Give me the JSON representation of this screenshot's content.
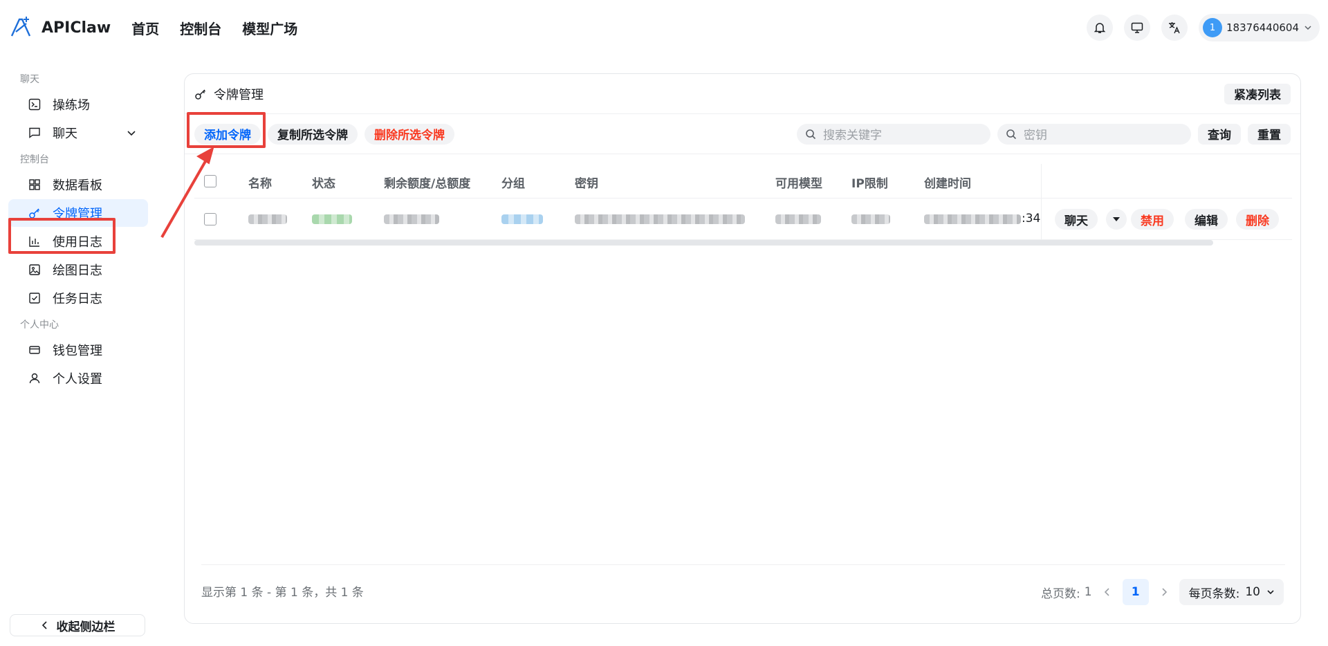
{
  "header": {
    "brand": "APIClaw",
    "nav": [
      "首页",
      "控制台",
      "模型广场"
    ],
    "user": {
      "avatar_letter": "1",
      "name": "18376440604"
    }
  },
  "sidebar": {
    "sections": [
      {
        "title": "聊天",
        "items": [
          "操练场",
          "聊天"
        ]
      },
      {
        "title": "控制台",
        "items": [
          "数据看板",
          "令牌管理",
          "使用日志",
          "绘图日志",
          "任务日志"
        ]
      },
      {
        "title": "个人中心",
        "items": [
          "钱包管理",
          "个人设置"
        ]
      }
    ],
    "collapse_label": "收起侧边栏"
  },
  "panel": {
    "title": "令牌管理",
    "compact_label": "紧凑列表",
    "toolbar": {
      "add": "添加令牌",
      "copy_selected": "复制所选令牌",
      "delete_selected": "删除所选令牌",
      "search_placeholder": "搜索关键字",
      "key_placeholder": "密钥",
      "query": "查询",
      "reset": "重置"
    },
    "columns": [
      "名称",
      "状态",
      "剩余额度/总额度",
      "分组",
      "密钥",
      "可用模型",
      "IP限制",
      "创建时间"
    ],
    "row": {
      "created_suffix": ":34",
      "actions": {
        "chat": "聊天",
        "disable": "禁用",
        "edit": "编辑",
        "delete": "删除"
      }
    },
    "footer": {
      "info": "显示第 1 条 - 第 1 条，共 1 条",
      "total_pages_label": "总页数:",
      "total_pages": "1",
      "current_page": "1",
      "page_size_label": "每页条数:",
      "page_size": "10"
    }
  },
  "colors": {
    "accent": "#0064fa",
    "danger": "#f93920",
    "highlight": "#e8413b"
  }
}
